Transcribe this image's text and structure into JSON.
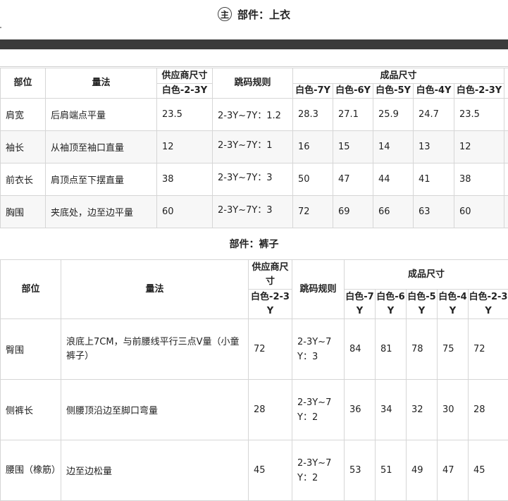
{
  "top_section": {
    "badge": "主",
    "title": "部件：上衣"
  },
  "table1": {
    "headers": {
      "part": "部位",
      "method": "量法",
      "supplier": "供应商尺寸",
      "supplier_sub": "白色-2-3Y",
      "rule": "跳码规则",
      "finished": "成品尺寸",
      "sizes": [
        "白色-7Y",
        "白色-6Y",
        "白色-5Y",
        "白色-4Y",
        "白色-2-3Y"
      ]
    },
    "rows": [
      {
        "part": "肩宽",
        "method": "后肩端点平量",
        "supplier": "23.5",
        "rule": "2-3Y~7Y：1.2",
        "sizes": [
          "28.3",
          "27.1",
          "25.9",
          "24.7",
          "23.5"
        ]
      },
      {
        "part": "袖长",
        "method": "从袖顶至袖口直量",
        "supplier": "12",
        "rule": "2-3Y~7Y：1",
        "sizes": [
          "16",
          "15",
          "14",
          "13",
          "12"
        ]
      },
      {
        "part": "前衣长",
        "method": "肩顶点至下摆直量",
        "supplier": "38",
        "rule": "2-3Y~7Y：3",
        "sizes": [
          "50",
          "47",
          "44",
          "41",
          "38"
        ]
      },
      {
        "part": "胸围",
        "method": "夹底处，边至边平量",
        "supplier": "60",
        "rule": "2-3Y~7Y：3",
        "sizes": [
          "72",
          "69",
          "66",
          "63",
          "60"
        ]
      }
    ]
  },
  "section2": {
    "title": "部件：裤子"
  },
  "table2": {
    "headers": {
      "part": "部位",
      "method": "量法",
      "supplier": "供应商尺寸",
      "supplier_sub": "白色-2-3Y",
      "rule": "跳码规则",
      "finished": "成品尺寸",
      "sizes": [
        "白色-7Y",
        "白色-6Y",
        "白色-5Y",
        "白色-4Y",
        "白色-2-3Y"
      ]
    },
    "rows": [
      {
        "part": "臀围",
        "method": "浪底上7CM，与前腰线平行三点V量（小童裤子）",
        "supplier": "72",
        "rule": "2-3Y~7Y：3",
        "sizes": [
          "84",
          "81",
          "78",
          "75",
          "72"
        ]
      },
      {
        "part": "侧裤长",
        "method": "侧腰顶沿边至脚口弯量",
        "supplier": "28",
        "rule": "2-3Y~7Y：2",
        "sizes": [
          "36",
          "34",
          "32",
          "30",
          "28"
        ]
      },
      {
        "part": "腰围（橡筋）",
        "method": "边至边松量",
        "supplier": "45",
        "rule": "2-3Y~7Y：2",
        "sizes": [
          "53",
          "51",
          "49",
          "47",
          "45"
        ]
      }
    ]
  }
}
